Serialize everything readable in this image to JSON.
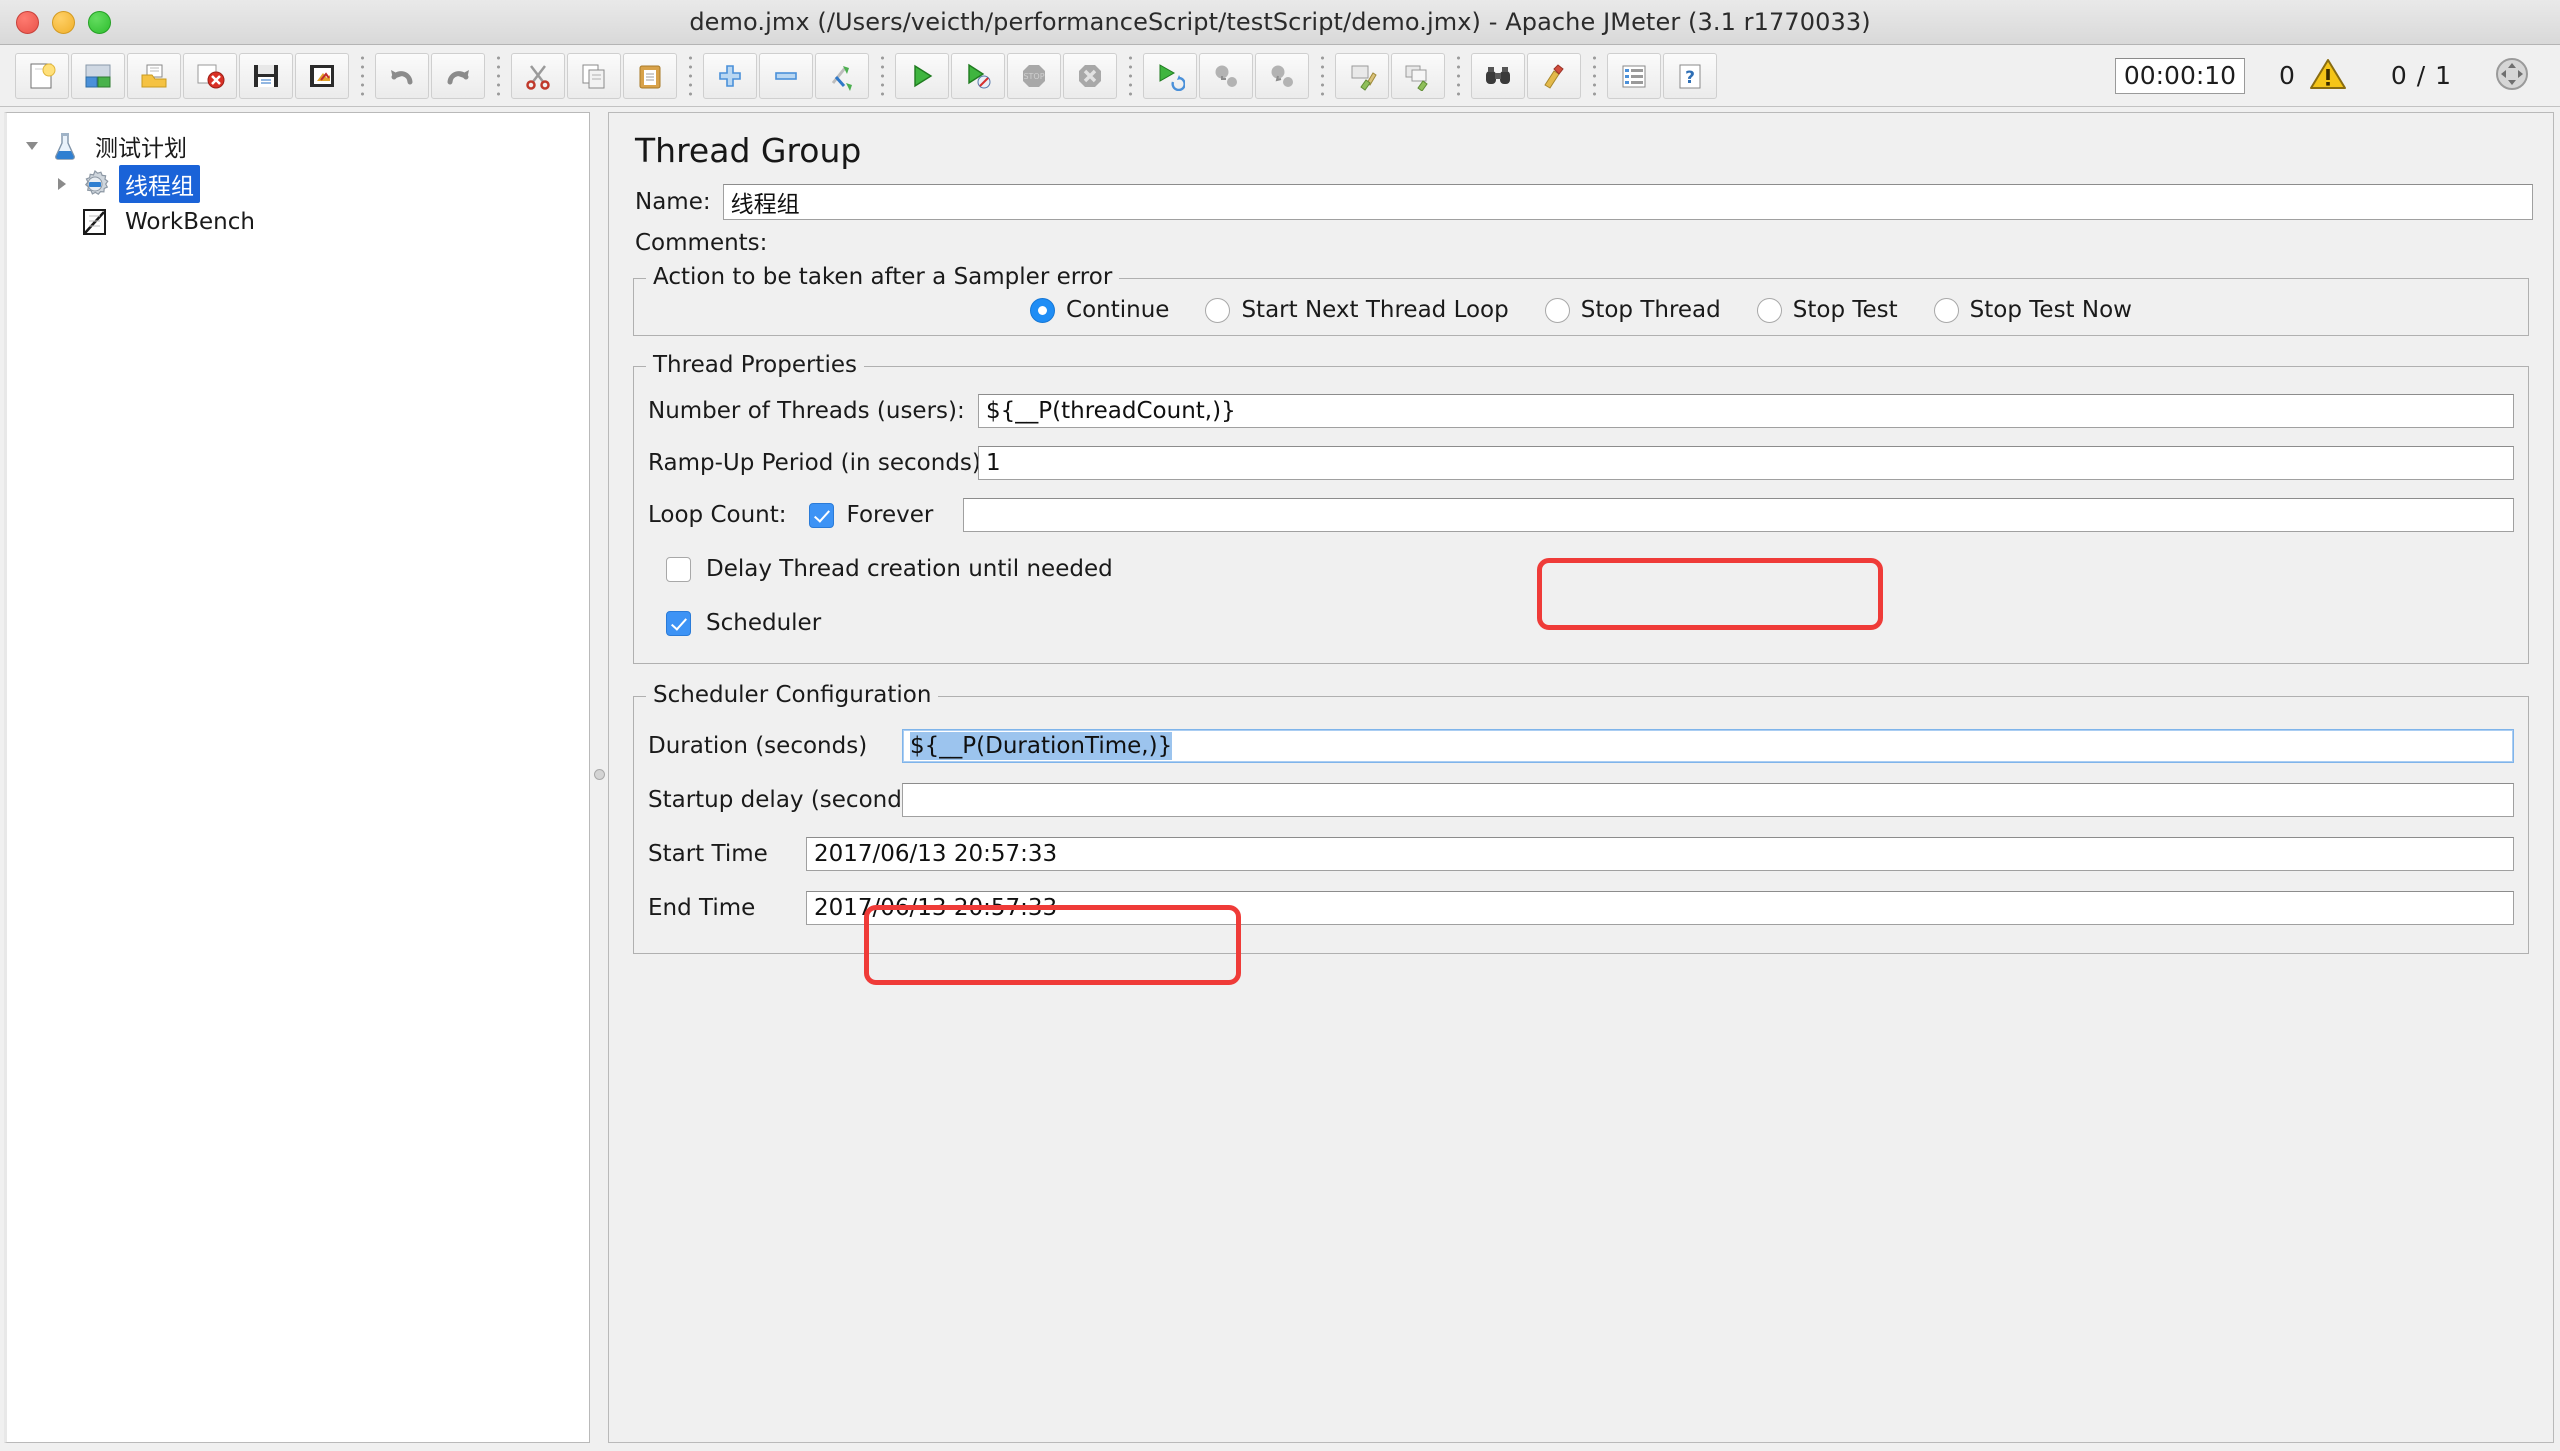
{
  "window": {
    "title": "demo.jmx (/Users/veicth/performanceScript/testScript/demo.jmx) - Apache JMeter (3.1 r1770033)",
    "traffic_lights": [
      "close-button",
      "minimize-button",
      "zoom-button"
    ]
  },
  "toolbar": {
    "buttons": [
      {
        "name": "new-test-plan",
        "icon": "new-document-icon"
      },
      {
        "name": "templates",
        "icon": "templates-icon"
      },
      {
        "name": "open",
        "icon": "open-folder-icon"
      },
      {
        "name": "close",
        "icon": "close-red-x-icon"
      },
      {
        "name": "save",
        "icon": "save-disk-icon"
      },
      {
        "name": "save-as",
        "icon": "save-as-icon"
      },
      {
        "name": "undo",
        "icon": "undo-arrow-icon"
      },
      {
        "name": "redo",
        "icon": "redo-arrow-icon"
      },
      {
        "name": "cut",
        "icon": "scissors-icon"
      },
      {
        "name": "copy",
        "icon": "copy-icon"
      },
      {
        "name": "paste",
        "icon": "clipboard-paste-icon"
      },
      {
        "name": "expand-all",
        "icon": "plus-icon"
      },
      {
        "name": "collapse-all",
        "icon": "minus-icon"
      },
      {
        "name": "toggle",
        "icon": "toggle-icon"
      },
      {
        "name": "start",
        "icon": "green-play-icon"
      },
      {
        "name": "start-no-timers",
        "icon": "green-play-no-timer-icon"
      },
      {
        "name": "stop",
        "icon": "stop-octagon-icon"
      },
      {
        "name": "shutdown",
        "icon": "shutdown-x-icon"
      },
      {
        "name": "start-remote-all",
        "icon": "remote-start-icon"
      },
      {
        "name": "stop-remote-all",
        "icon": "remote-stop-icon"
      },
      {
        "name": "shutdown-remote-all",
        "icon": "remote-shutdown-icon"
      },
      {
        "name": "clear",
        "icon": "broom-clear-icon"
      },
      {
        "name": "clear-all",
        "icon": "broom-clear-all-icon"
      },
      {
        "name": "search",
        "icon": "binoculars-search-icon"
      },
      {
        "name": "reset-search",
        "icon": "reset-search-icon"
      },
      {
        "name": "function-helper",
        "icon": "function-helper-icon"
      },
      {
        "name": "help",
        "icon": "question-help-icon"
      }
    ],
    "elapsed_time": "00:00:10",
    "error_count": "0",
    "thread_count": "0 / 1",
    "warning_icon": "warning-triangle-icon",
    "status_icon": "connection-status-icon"
  },
  "tree": {
    "nodes": [
      {
        "label": "测试计划",
        "icon": "test-plan-flask-icon",
        "expanded": true,
        "selected": false,
        "level": 0
      },
      {
        "label": "线程组",
        "icon": "thread-group-gear-icon",
        "expanded": false,
        "selected": true,
        "level": 1
      },
      {
        "label": "WorkBench",
        "icon": "workbench-icon",
        "expanded": null,
        "selected": false,
        "level": 1
      }
    ]
  },
  "main": {
    "panel_title": "Thread Group",
    "name_label": "Name:",
    "name_value": "线程组",
    "comments_label": "Comments:",
    "comments_value": "",
    "sampler_error": {
      "legend": "Action to be taken after a Sampler error",
      "options": [
        {
          "label": "Continue",
          "selected": true
        },
        {
          "label": "Start Next Thread Loop",
          "selected": false
        },
        {
          "label": "Stop Thread",
          "selected": false
        },
        {
          "label": "Stop Test",
          "selected": false
        },
        {
          "label": "Stop Test Now",
          "selected": false
        }
      ]
    },
    "thread_properties": {
      "legend": "Thread Properties",
      "num_threads_label": "Number of Threads (users):",
      "num_threads_value": "${__P(threadCount,)}",
      "ramp_up_label": "Ramp-Up Period (in seconds):",
      "ramp_up_value": "1",
      "loop_count_label": "Loop Count:",
      "forever_label": "Forever",
      "forever_checked": true,
      "loop_count_value": "",
      "delay_thread_label": "Delay Thread creation until needed",
      "delay_thread_checked": false,
      "scheduler_label": "Scheduler",
      "scheduler_checked": true
    },
    "scheduler_config": {
      "legend": "Scheduler Configuration",
      "duration_label": "Duration (seconds)",
      "duration_value": "${__P(DurationTime,)}",
      "duration_selected": true,
      "startup_delay_label": "Startup delay (seconds)",
      "startup_delay_value": "",
      "start_time_label": "Start Time",
      "start_time_value": "2017/06/13 20:57:33",
      "end_time_label": "End Time",
      "end_time_value": "2017/06/13 20:57:33"
    }
  },
  "annotations": {
    "accent_color": "#ef3b38",
    "highlight_color": "#1a63d8",
    "selection_color": "#9cc4ee",
    "items": [
      {
        "name": "annotation-threads-field",
        "target": "num_threads_value"
      },
      {
        "name": "annotation-duration-field",
        "target": "duration_value"
      }
    ]
  }
}
